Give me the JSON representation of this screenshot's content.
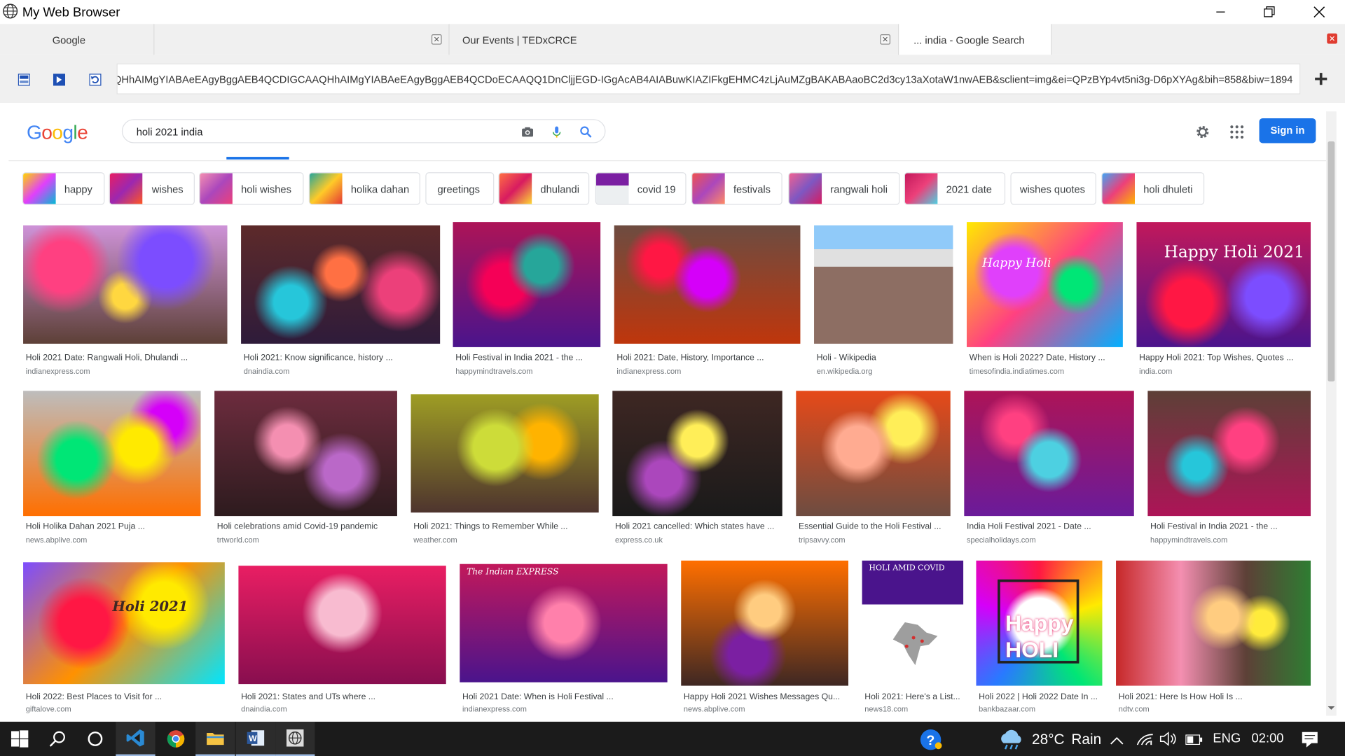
{
  "window": {
    "title": "My Web Browser"
  },
  "tabs": [
    {
      "label": "Google"
    },
    {
      "label": ""
    },
    {
      "label": "Our Events | TEDxCRCE"
    },
    {
      "label": "... india - Google Search"
    }
  ],
  "address": {
    "url": "ARgAMgUIABCABDIGCAAQHhAIMgYIABAeEAgyBggAEB4QCDIGCAAQHhAIMgYIABAeEAgyBggAEB4QCDoECAAQQ1DnCljjEGD-IGgAcAB4AIABuwKIAZIFkgEHMC4zLjAuMZgBAKABAaoBC2d3cy13aXotaW1nwAEB&sclient=img&ei=QPzBYp4vt5ni3g-D6pXYAg&bih=858&biw=1894"
  },
  "google": {
    "logo": "Google",
    "query": "holi 2021 india",
    "signin_label": "Sign in"
  },
  "chips": [
    {
      "label": "happy"
    },
    {
      "label": "wishes"
    },
    {
      "label": "holi wishes"
    },
    {
      "label": "holika dahan"
    },
    {
      "label": "greetings"
    },
    {
      "label": "dhulandi"
    },
    {
      "label": "covid 19"
    },
    {
      "label": "festivals"
    },
    {
      "label": "rangwali holi"
    },
    {
      "label": "2021 date"
    },
    {
      "label": "wishes quotes"
    },
    {
      "label": "holi dhuleti"
    }
  ],
  "results": [
    {
      "title": "Holi 2021 Date: Rangwali Holi, Dhulandi ...",
      "source": "indianexpress.com",
      "overlay": ""
    },
    {
      "title": "Holi 2021: Know significance, history ...",
      "source": "dnaindia.com",
      "overlay": ""
    },
    {
      "title": "Holi Festival in India 2021 - the ...",
      "source": "happymindtravels.com",
      "overlay": ""
    },
    {
      "title": "Holi 2021: Date, History, Importance ...",
      "source": "indianexpress.com",
      "overlay": ""
    },
    {
      "title": "Holi - Wikipedia",
      "source": "en.wikipedia.org",
      "overlay": ""
    },
    {
      "title": "When is Holi 2022? Date, History ...",
      "source": "timesofindia.indiatimes.com",
      "overlay": "Happy Holi"
    },
    {
      "title": "Happy Holi 2021: Top Wishes, Quotes ...",
      "source": "india.com",
      "overlay": "Happy Holi 2021"
    },
    {
      "title": "Holi Holika Dahan 2021 Puja ...",
      "source": "news.abplive.com",
      "overlay": ""
    },
    {
      "title": "Holi celebrations amid Covid-19 pandemic",
      "source": "trtworld.com",
      "overlay": ""
    },
    {
      "title": "Holi 2021: Things to Remember While ...",
      "source": "weather.com",
      "overlay": ""
    },
    {
      "title": "Holi 2021 cancelled: Which states have ...",
      "source": "express.co.uk",
      "overlay": ""
    },
    {
      "title": "Essential Guide to the Holi Festival ...",
      "source": "tripsavvy.com",
      "overlay": ""
    },
    {
      "title": "India Holi Festival 2021 - Date ...",
      "source": "specialholidays.com",
      "overlay": ""
    },
    {
      "title": "Holi Festival in India 2021 - the ...",
      "source": "happymindtravels.com",
      "overlay": ""
    },
    {
      "title": "Holi 2022: Best Places to Visit for ...",
      "source": "giftalove.com",
      "overlay": "Holi 2021"
    },
    {
      "title": "Holi 2021: States and UTs where ...",
      "source": "dnaindia.com",
      "overlay": ""
    },
    {
      "title": "Holi 2021 Date: When is Holi Festival ...",
      "source": "indianexpress.com",
      "overlay": "The Indian EXPRESS"
    },
    {
      "title": "Happy Holi 2021 Wishes Messages Qu...",
      "source": "news.abplive.com",
      "overlay": ""
    },
    {
      "title": "Holi 2021: Here's a List...",
      "source": "news18.com",
      "overlay": "HOLI AMID COVID"
    },
    {
      "title": "Holi 2022 | Holi 2022 Date In ...",
      "source": "bankbazaar.com",
      "overlay": "Happy HOLI"
    },
    {
      "title": "Holi 2021: Here Is How Holi Is ...",
      "source": "ndtv.com",
      "overlay": ""
    }
  ],
  "taskbar": {
    "temperature": "28°C",
    "weather": "Rain",
    "language": "ENG",
    "time": "02:00"
  },
  "colors": {
    "accent": "#1a73e8",
    "taskbar": "#1b1b1b"
  }
}
